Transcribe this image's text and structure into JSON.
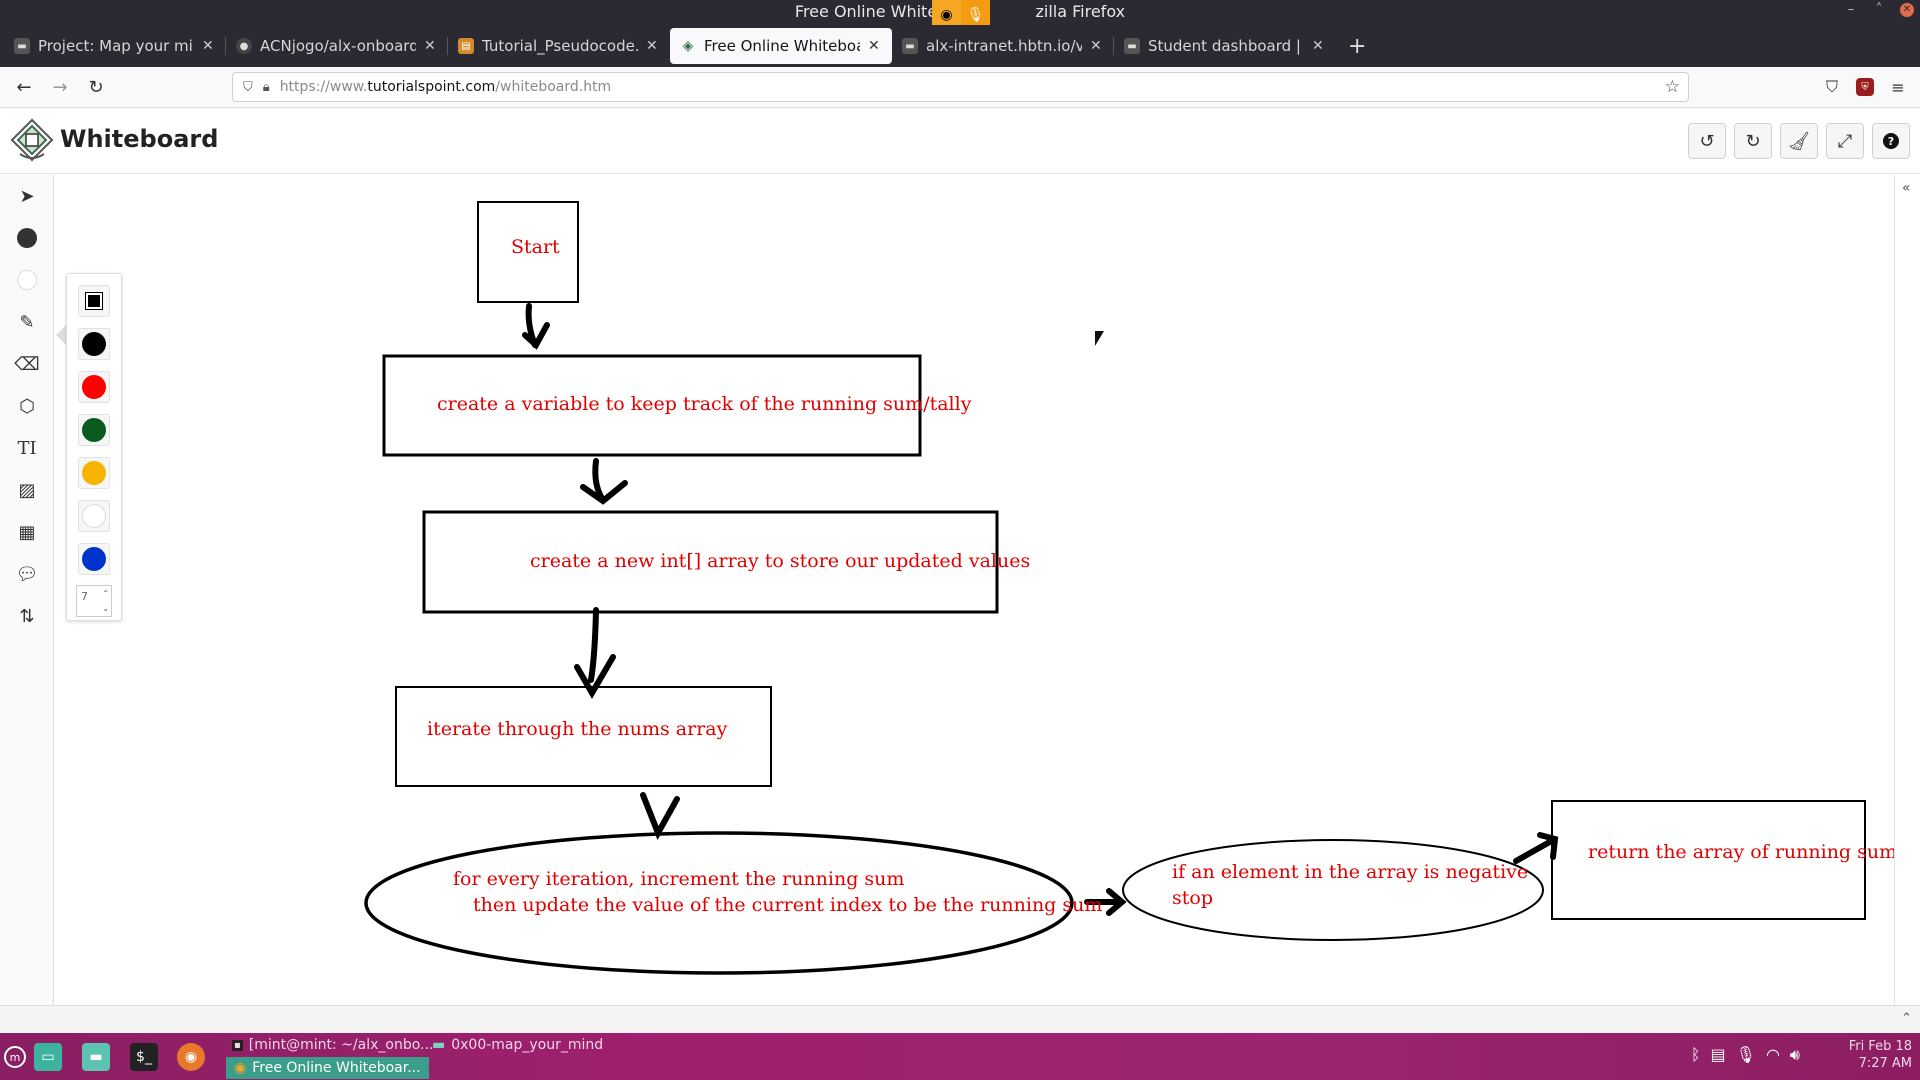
{
  "window": {
    "title": "Free Online Whiteboard — Mozilla Firefox",
    "title_visible": "Free Online Whiteboar",
    "title_suffix": "zilla Firefox"
  },
  "tabs": [
    {
      "label": "Project: Map your mind |",
      "icon": "site-icon",
      "active": false
    },
    {
      "label": "ACNjogo/alx-onboarding",
      "icon": "github-icon",
      "active": false
    },
    {
      "label": "Tutorial_Pseudocode.pdf",
      "icon": "pdf-icon",
      "active": false
    },
    {
      "label": "Free Online Whiteboard",
      "icon": "whiteboard-icon",
      "active": true
    },
    {
      "label": "alx-intranet.hbtn.io/video",
      "icon": "site-icon",
      "active": false
    },
    {
      "label": "Student dashboard | Nair",
      "icon": "site-icon",
      "active": false
    }
  ],
  "url": {
    "prefix": "https://www.",
    "domain": "tutorialspoint.com",
    "path": "/whiteboard.htm"
  },
  "app": {
    "title": "Whiteboard",
    "header_buttons": [
      "undo-icon",
      "redo-icon",
      "clear-icon",
      "fullscreen-icon",
      "help-icon"
    ]
  },
  "tools": [
    "select-icon",
    "fill-circle-icon",
    "hollow-circle-icon",
    "pencil-icon",
    "eraser-icon",
    "shapes-icon",
    "text-icon",
    "image-icon",
    "image-text-icon",
    "comment-icon",
    "sort-icon"
  ],
  "palette": {
    "colors": [
      "#000000",
      "#ff0000",
      "#0a5c1e",
      "#f5b400",
      "#ffffff",
      "#0033cc"
    ],
    "stroke_size": "7"
  },
  "flowchart": {
    "start": "Start",
    "step1": "create a variable to keep track of the running sum/tally",
    "step2": "create a new int[] array to store our updated values",
    "step3": "iterate through the nums array",
    "step4_line1": "for every iteration, increment the running sum",
    "step4_line2": "then update the value of the current index to be the running sum",
    "condition_line1": "if an element in the array is negative",
    "condition_line2": "stop",
    "result": "return the array of running sums",
    "text_color": "#e00000"
  },
  "taskbar": {
    "tasks": [
      {
        "label": "[mint@mint: ~/alx_onbo...",
        "icon": "terminal-icon"
      },
      {
        "label": "0x00-map_your_mind",
        "icon": "folder-icon"
      },
      {
        "label": "Free Online Whiteboar...",
        "icon": "firefox-icon"
      }
    ],
    "date": "Fri Feb 18",
    "time": "7:27 AM"
  }
}
